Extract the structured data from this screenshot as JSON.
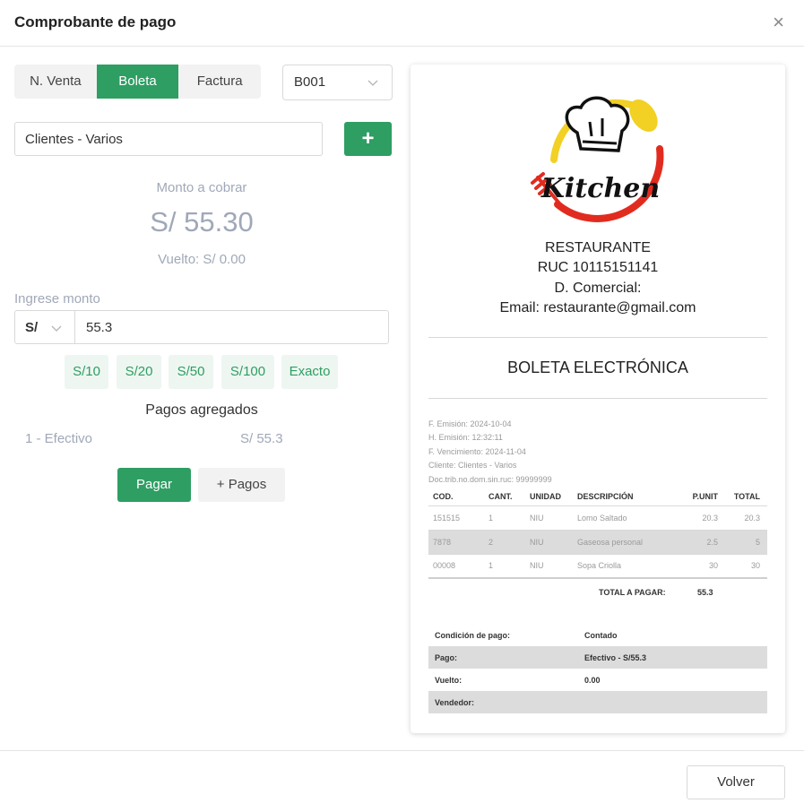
{
  "modal": {
    "title": "Comprobante de pago",
    "close_label": "×"
  },
  "doc_tabs": [
    {
      "label": "N. Venta",
      "active": false
    },
    {
      "label": "Boleta",
      "active": true
    },
    {
      "label": "Factura",
      "active": false
    }
  ],
  "serie": {
    "value": "B001"
  },
  "client": {
    "value": "Clientes - Varios",
    "add_label": "+"
  },
  "amount_due": {
    "label": "Monto a cobrar",
    "value": "S/ 55.30",
    "change": "Vuelto: S/ 0.00"
  },
  "payment_input": {
    "label": "Ingrese monto",
    "currency": "S/",
    "value": "55.3"
  },
  "quick_amounts": [
    "S/10",
    "S/20",
    "S/50",
    "S/100",
    "Exacto"
  ],
  "payments": {
    "title": "Pagos agregados",
    "items": [
      {
        "method": "1 - Efectivo",
        "amount": "S/ 55.3"
      }
    ]
  },
  "actions": {
    "pay": "Pagar",
    "more_payments": "+ Pagos",
    "back": "Volver"
  },
  "receipt": {
    "company": {
      "name": "RESTAURANTE",
      "ruc": "RUC 10115151141",
      "commercial": "D. Comercial:",
      "email": "Email: restaurante@gmail.com",
      "logo_text": "Kitchen"
    },
    "doc_type": "BOLETA ELECTRÓNICA",
    "meta": {
      "emision": "F. Emisión: 2024-10-04",
      "hora": "H. Emisión: 12:32:11",
      "vencimiento": "F. Vencimiento: 2024-11-04",
      "cliente": "Cliente: Clientes - Varios",
      "doc": "Doc.trib.no.dom.sin.ruc: 99999999"
    },
    "columns": [
      "COD.",
      "CANT.",
      "UNIDAD",
      "DESCRIPCIÓN",
      "P.UNIT",
      "TOTAL"
    ],
    "items": [
      {
        "cod": "151515",
        "cant": "1",
        "unidad": "NIU",
        "desc": "Lomo Saltado",
        "punit": "20.3",
        "total": "20.3"
      },
      {
        "cod": "7878",
        "cant": "2",
        "unidad": "NIU",
        "desc": "Gaseosa personal",
        "punit": "2.5",
        "total": "5"
      },
      {
        "cod": "00008",
        "cant": "1",
        "unidad": "NIU",
        "desc": "Sopa Criolla",
        "punit": "30",
        "total": "30"
      }
    ],
    "total_label": "TOTAL A PAGAR:",
    "total_value": "55.3",
    "payment_info": [
      {
        "label": "Condición de pago:",
        "value": "Contado"
      },
      {
        "label": "Pago:",
        "value": "Efectivo - S/55.3"
      },
      {
        "label": "Vuelto:",
        "value": "0.00"
      },
      {
        "label": "Vendedor:",
        "value": ""
      }
    ]
  },
  "colors": {
    "accent": "#2e9e63",
    "muted_text": "#a0a8b8",
    "logo_yellow": "#f2d024",
    "logo_red": "#e22b1f"
  }
}
